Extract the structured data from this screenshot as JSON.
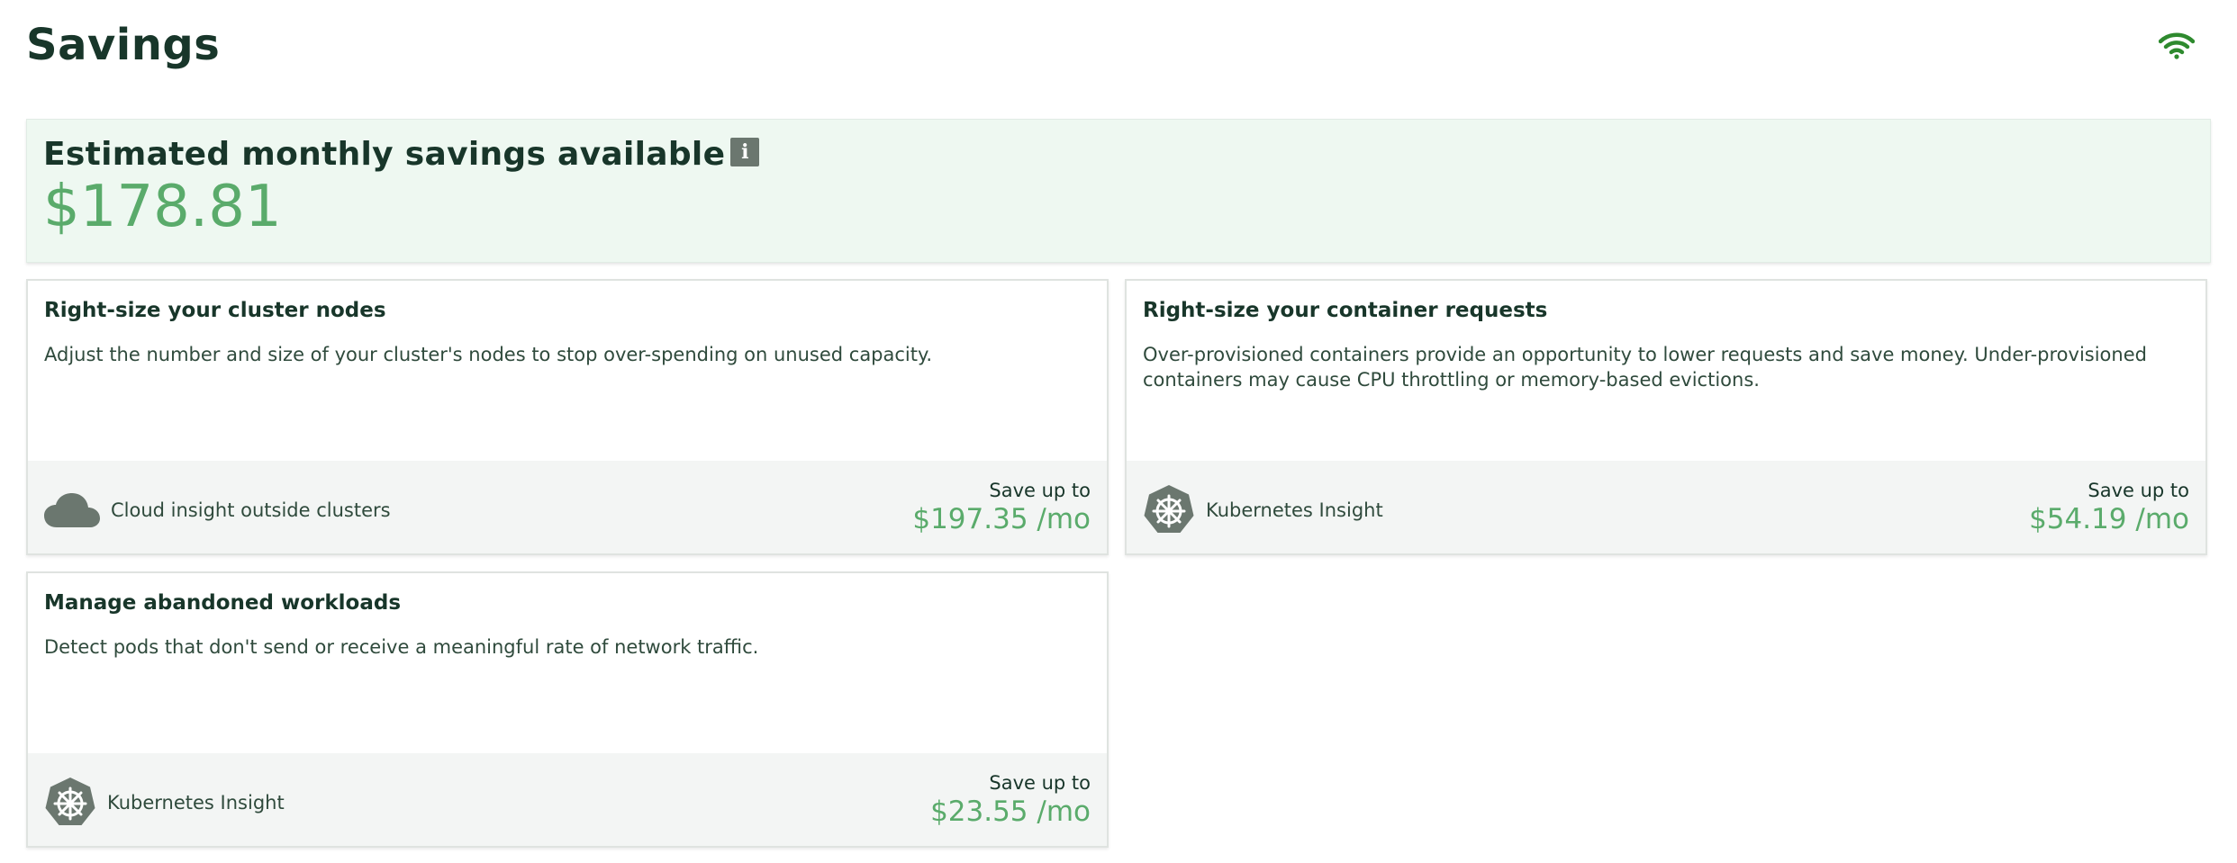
{
  "page": {
    "title": "Savings"
  },
  "summary": {
    "title": "Estimated monthly savings available",
    "info_icon_glyph": "i",
    "amount": "$178.81"
  },
  "cards": [
    {
      "title": "Right-size your cluster nodes",
      "description": "Adjust the number and size of your cluster's nodes to stop over-spending on unused capacity.",
      "source_label": "Cloud insight outside clusters",
      "source_icon": "cloud-icon",
      "save_label": "Save up to",
      "save_amount": "$197.35 /mo"
    },
    {
      "title": "Right-size your container requests",
      "description": "Over-provisioned containers provide an opportunity to lower requests and save money. Under-provisioned containers may cause CPU throttling or memory-based evictions.",
      "source_label": "Kubernetes Insight",
      "source_icon": "kubernetes-icon",
      "save_label": "Save up to",
      "save_amount": "$54.19 /mo"
    },
    {
      "title": "Manage abandoned workloads",
      "description": "Detect pods that don't send or receive a meaningful rate of network traffic.",
      "source_label": "Kubernetes Insight",
      "source_icon": "kubernetes-icon",
      "save_label": "Save up to",
      "save_amount": "$23.55 /mo"
    }
  ],
  "colors": {
    "accent_green": "#5aab6b",
    "summary_bg": "#eef8f1",
    "footer_bg": "#f3f5f4",
    "icon_gray": "#6b776f",
    "wifi_green": "#2e8a2e"
  },
  "icons": {
    "status": "wifi-icon"
  }
}
